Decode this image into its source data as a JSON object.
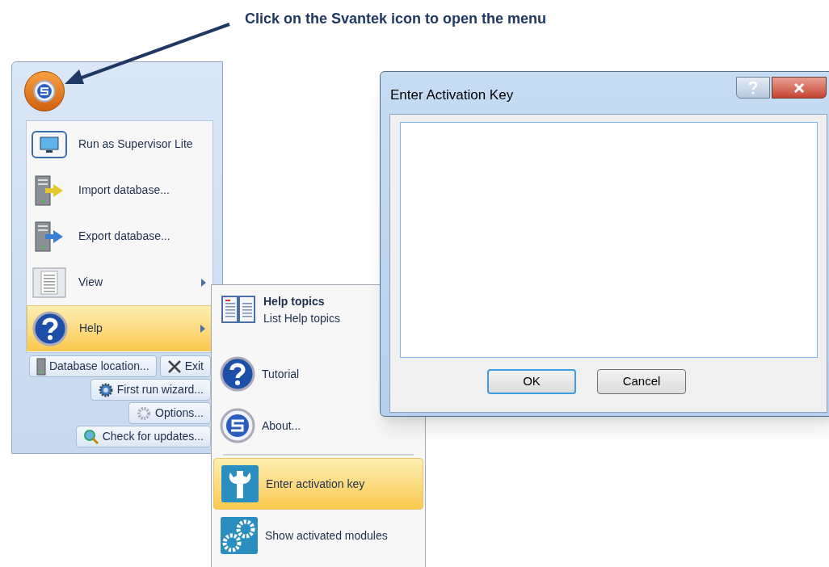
{
  "annotation": {
    "text": "Click on the Svantek icon to open the menu"
  },
  "app_menu": {
    "items": [
      {
        "label": "Run as Supervisor Lite",
        "kind": "command",
        "selected": false
      },
      {
        "label": "Import database...",
        "kind": "command",
        "selected": false
      },
      {
        "label": "Export database...",
        "kind": "command",
        "selected": false
      },
      {
        "label": "View",
        "kind": "submenu",
        "selected": false
      },
      {
        "label": "Help",
        "kind": "submenu",
        "selected": true
      }
    ],
    "footer_rows": [
      [
        {
          "label": "Database location..."
        },
        {
          "label": "Exit"
        }
      ],
      [
        {
          "label": "First run wizard..."
        }
      ],
      [
        {
          "label": "Options..."
        }
      ],
      [
        {
          "label": "Check for updates..."
        }
      ]
    ]
  },
  "help_submenu": {
    "items": [
      {
        "title": "Help topics",
        "description": "List Help topics",
        "selected": false
      },
      {
        "title": "Tutorial",
        "selected": false
      },
      {
        "title": "About...",
        "selected": false
      },
      {
        "title": "Enter activation key",
        "selected": true,
        "separator_before": true
      },
      {
        "title": "Show activated modules",
        "selected": false
      }
    ]
  },
  "dialog": {
    "title": "Enter Activation Key",
    "buttons": [
      {
        "label": "OK",
        "default": true
      },
      {
        "label": "Cancel",
        "default": false
      }
    ]
  }
}
